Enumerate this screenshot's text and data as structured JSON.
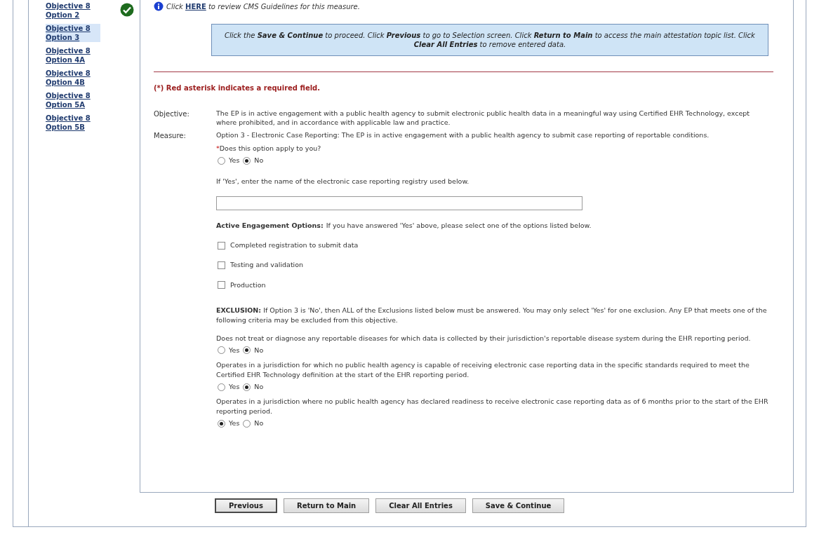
{
  "sidebar": {
    "items": [
      {
        "label": "Objective 8 Option 2",
        "selected": false,
        "completed": true
      },
      {
        "label": "Objective 8 Option 3",
        "selected": true,
        "completed": false
      },
      {
        "label": "Objective 8 Option 4A",
        "selected": false,
        "completed": false
      },
      {
        "label": "Objective 8 Option 4B",
        "selected": false,
        "completed": false
      },
      {
        "label": "Objective 8 Option 5A",
        "selected": false,
        "completed": false
      },
      {
        "label": "Objective 8 Option 5B",
        "selected": false,
        "completed": false
      }
    ]
  },
  "info": {
    "before": "Click",
    "link": "HERE",
    "after": "to review CMS Guidelines for this measure."
  },
  "instructions": "Click the **Save & Continue** to proceed. Click **Previous** to go to Selection screen. Click **Return to Main** to access the main attestation topic list. Click **Clear All Entries** to remove entered data.",
  "required_note": "(*) Red asterisk indicates a required field.",
  "objective": {
    "label": "Objective:",
    "text": "The EP is in active engagement with a public health agency to submit electronic public health data in a meaningful way using Certified EHR Technology, except where prohibited, and in accordance with applicable law and practice."
  },
  "measure": {
    "label": "Measure:",
    "text": "Option 3 - Electronic Case Reporting: The EP is in active engagement with a public health agency to submit case reporting of reportable conditions."
  },
  "question": {
    "asterisk": "*",
    "text": "Does this option apply to you?",
    "options": [
      {
        "label": "Yes",
        "selected": false
      },
      {
        "label": "No",
        "selected": true
      }
    ]
  },
  "registry": {
    "prompt": "If 'Yes', enter the name of the electronic case reporting registry used below."
  },
  "engagement": {
    "heading": "Active Engagement Options:",
    "text": "If you have answered 'Yes' above, please select one of the options listed below.",
    "options": [
      {
        "label": "Completed registration to submit data",
        "checked": false
      },
      {
        "label": "Testing and validation",
        "checked": false
      },
      {
        "label": "Production",
        "checked": false
      }
    ]
  },
  "exclusion": {
    "heading": "EXCLUSION:",
    "text": "If Option 3 is 'No', then ALL of the Exclusions listed below must be answered. You may only select 'Yes' for one exclusion. Any EP that meets one of the following criteria may be excluded from this objective."
  },
  "exclusions": [
    {
      "text": "Does not treat or diagnose any reportable diseases for which data is collected by their jurisdiction's reportable disease system during the EHR reporting period.",
      "options": [
        {
          "label": "Yes",
          "selected": false
        },
        {
          "label": "No",
          "selected": true
        }
      ]
    },
    {
      "text": "Operates in a jurisdiction for which no public health agency is capable of receiving electronic case reporting data in the specific standards required to meet the Certified EHR Technology definition at the start of the EHR reporting period.",
      "options": [
        {
          "label": "Yes",
          "selected": false
        },
        {
          "label": "No",
          "selected": true
        }
      ]
    },
    {
      "text": "Operates in a jurisdiction where no public health agency has declared readiness to receive electronic case reporting data as of 6 months prior to the start of the EHR reporting period.",
      "options": [
        {
          "label": "Yes",
          "selected": true
        },
        {
          "label": "No",
          "selected": false
        }
      ]
    }
  ],
  "buttons": [
    {
      "label": "Previous",
      "focused": true
    },
    {
      "label": "Return to Main",
      "focused": false
    },
    {
      "label": "Clear All Entries",
      "focused": false
    },
    {
      "label": "Save & Continue",
      "focused": false
    }
  ]
}
